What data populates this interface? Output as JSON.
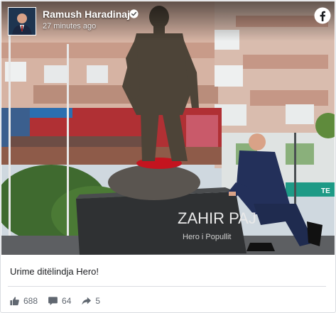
{
  "post": {
    "author": "Ramush Haradinaj",
    "timestamp": "27 minutes ago",
    "caption": "Urime ditëlindja Hero!"
  },
  "photo": {
    "monument_inscription_line1": "ZAHIR PAJ",
    "monument_inscription_line2": "Hero i Popullit",
    "shop_sign": "TE"
  },
  "actions": {
    "likes": "688",
    "comments": "64",
    "shares": "5"
  },
  "colors": {
    "brand": "#1877f2",
    "muted": "#606770",
    "text": "#1c1e21"
  }
}
